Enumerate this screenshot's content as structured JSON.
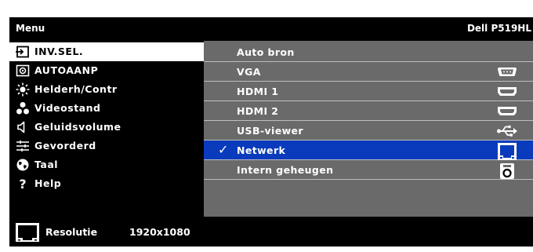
{
  "header": {
    "title": "Menu",
    "model": "Dell P519HL"
  },
  "menu": {
    "items": [
      {
        "label": "INV.SEL.",
        "icon": "input-select-icon",
        "selected": true
      },
      {
        "label": "AUTOAANP",
        "icon": "auto-adjust-icon"
      },
      {
        "label": "Helderh/Contr",
        "icon": "brightness-icon"
      },
      {
        "label": "Videostand",
        "icon": "video-mode-icon"
      },
      {
        "label": "Geluidsvolume",
        "icon": "volume-icon"
      },
      {
        "label": "Gevorderd",
        "icon": "advanced-settings-icon"
      },
      {
        "label": "Taal",
        "icon": "language-globe-icon"
      },
      {
        "label": "Help",
        "icon": "help-icon"
      }
    ]
  },
  "submenu": {
    "items": [
      {
        "label": "Auto bron",
        "icon": ""
      },
      {
        "label": "VGA",
        "icon": "vga-port-icon"
      },
      {
        "label": "HDMI 1",
        "icon": "hdmi-port-icon"
      },
      {
        "label": "HDMI 2",
        "icon": "hdmi-port-icon"
      },
      {
        "label": "USB-viewer",
        "icon": "usb-icon"
      },
      {
        "label": "Netwerk",
        "icon": "network-port-icon",
        "checked": true,
        "check_mark": "✓"
      },
      {
        "label": "Intern geheugen",
        "icon": "internal-memory-icon"
      }
    ]
  },
  "footer": {
    "label": "Resolutie",
    "value": "1920x1080",
    "icon": "resolution-icon"
  },
  "colors": {
    "background": "#000000",
    "submenu_bg": "#6a6a6a",
    "selected_item": "#0a3bbd",
    "menu_selected": "#ffffff"
  }
}
